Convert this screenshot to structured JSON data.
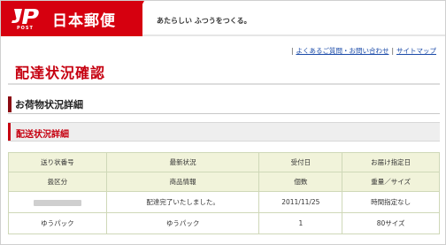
{
  "header": {
    "logo_text": "日本郵便",
    "logo_sub": "POST",
    "tagline": "あたらしい ふつうをつくる。",
    "brand_color": "#d6000f"
  },
  "toplinks": {
    "faq": "よくあるご質問・お問い合わせ",
    "sitemap": "サイトマップ"
  },
  "page": {
    "title": "配達状況確認"
  },
  "section1": {
    "label": "お荷物状況詳細"
  },
  "section2": {
    "label": "配送状況詳細"
  },
  "table": {
    "header_row1": [
      "送り状番号",
      "最新状況",
      "受付日",
      "お届け指定日"
    ],
    "header_row2": [
      "扱区分",
      "商品情報",
      "個数",
      "重量／サイズ"
    ],
    "data_row1": [
      "",
      "配達完了いたしました。",
      "2011/11/25",
      "時間指定なし"
    ],
    "data_row2": [
      "ゆうパック",
      "ゆうパック",
      "1",
      "80サイズ"
    ]
  }
}
